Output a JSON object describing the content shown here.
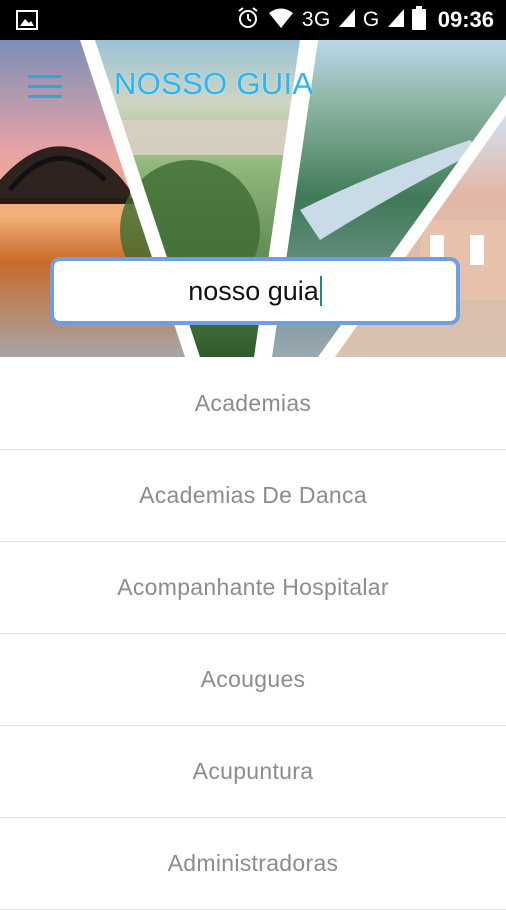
{
  "status_bar": {
    "network": "3G",
    "network2": "G",
    "time": "09:36"
  },
  "header": {
    "title": "NOSSO GUIA",
    "menu_icon": "hamburger-menu-icon"
  },
  "search": {
    "value": "nosso guia"
  },
  "categories": [
    {
      "label": "Academias"
    },
    {
      "label": "Academias De Danca"
    },
    {
      "label": "Acompanhante Hospitalar"
    },
    {
      "label": "Acougues"
    },
    {
      "label": "Acupuntura"
    },
    {
      "label": "Administradoras"
    }
  ],
  "colors": {
    "accent": "#29b6f6",
    "search_border": "#6ea0e0",
    "list_text": "#8c8c8c"
  }
}
